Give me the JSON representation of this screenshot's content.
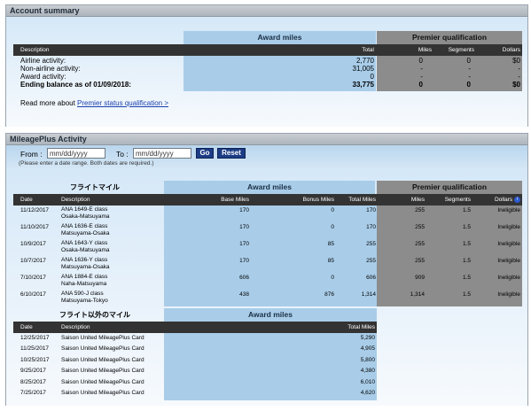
{
  "account_summary": {
    "title": "Account summary",
    "award_header": "Award miles",
    "premier_header": "Premier qualification",
    "col_description": "Description",
    "col_total": "Total",
    "col_miles": "Miles",
    "col_segments": "Segments",
    "col_dollars": "Dollars",
    "rows": [
      {
        "label": "Airline activity:",
        "total": "2,770",
        "miles": "0",
        "segments": "0",
        "dollars": "$0"
      },
      {
        "label": "Non-airline activity:",
        "total": "31,005",
        "miles": "-",
        "segments": "-",
        "dollars": "-"
      },
      {
        "label": "Award activity:",
        "total": "0",
        "miles": "-",
        "segments": "-",
        "dollars": "-"
      },
      {
        "label": "Ending balance as of 01/09/2018:",
        "total": "33,775",
        "miles": "0",
        "segments": "0",
        "dollars": "$0"
      }
    ],
    "read_more_prefix": "Read more about ",
    "read_more_link": "Premier status qualification >"
  },
  "activity": {
    "title": "MileagePlus Activity",
    "from_label": "From :",
    "to_label": "To :",
    "date_placeholder": "mm/dd/yyyy",
    "go_label": "Go",
    "reset_label": "Reset",
    "hint": "(Please enter a date range. Both dates are required.)",
    "flight_section_label": "フライトマイル",
    "award_header": "Award miles",
    "premier_header": "Premier qualification",
    "cols": {
      "date": "Date",
      "description": "Description",
      "base_miles": "Base Miles",
      "bonus_miles": "Bonus Miles",
      "total_miles": "Total Miles",
      "miles": "Miles",
      "segments": "Segments",
      "dollars": "Dollars"
    },
    "flights": [
      {
        "date": "11/12/2017",
        "desc1": "ANA 1649-E class",
        "desc2": "Osaka-Matsuyama",
        "base": "170",
        "bonus": "0",
        "total": "170",
        "miles": "255",
        "segments": "1.5",
        "dollars": "Ineligible"
      },
      {
        "date": "11/10/2017",
        "desc1": "ANA 1636-E class",
        "desc2": "Matsuyama-Osaka",
        "base": "170",
        "bonus": "0",
        "total": "170",
        "miles": "255",
        "segments": "1.5",
        "dollars": "Ineligible"
      },
      {
        "date": "10/9/2017",
        "desc1": "ANA 1643-Y class",
        "desc2": "Osaka-Matsuyama",
        "base": "170",
        "bonus": "85",
        "total": "255",
        "miles": "255",
        "segments": "1.5",
        "dollars": "Ineligible"
      },
      {
        "date": "10/7/2017",
        "desc1": "ANA 1636-Y class",
        "desc2": "Matsuyama-Osaka",
        "base": "170",
        "bonus": "85",
        "total": "255",
        "miles": "255",
        "segments": "1.5",
        "dollars": "Ineligible"
      },
      {
        "date": "7/10/2017",
        "desc1": "ANA 1884-E class",
        "desc2": "Naha-Matsuyama",
        "base": "606",
        "bonus": "0",
        "total": "606",
        "miles": "909",
        "segments": "1.5",
        "dollars": "Ineligible"
      },
      {
        "date": "6/10/2017",
        "desc1": "ANA 590-J class",
        "desc2": "Matsuyama-Tokyo",
        "base": "438",
        "bonus": "876",
        "total": "1,314",
        "miles": "1,314",
        "segments": "1.5",
        "dollars": "Ineligible"
      }
    ],
    "nonflight_section_label": "フライト以外のマイル",
    "nonflight_award_header": "Award miles",
    "nonflight_cols": {
      "date": "Date",
      "description": "Description",
      "total_miles": "Total Miles"
    },
    "nonflight": [
      {
        "date": "12/25/2017",
        "desc": "Saison United MileagePlus Card",
        "total": "5,290"
      },
      {
        "date": "11/25/2017",
        "desc": "Saison United MileagePlus Card",
        "total": "4,905"
      },
      {
        "date": "10/25/2017",
        "desc": "Saison United MileagePlus Card",
        "total": "5,800"
      },
      {
        "date": "9/25/2017",
        "desc": "Saison United MileagePlus Card",
        "total": "4,380"
      },
      {
        "date": "8/25/2017",
        "desc": "Saison United MileagePlus Card",
        "total": "6,010"
      },
      {
        "date": "7/25/2017",
        "desc": "Saison United MileagePlus Card",
        "total": "4,620"
      }
    ]
  }
}
